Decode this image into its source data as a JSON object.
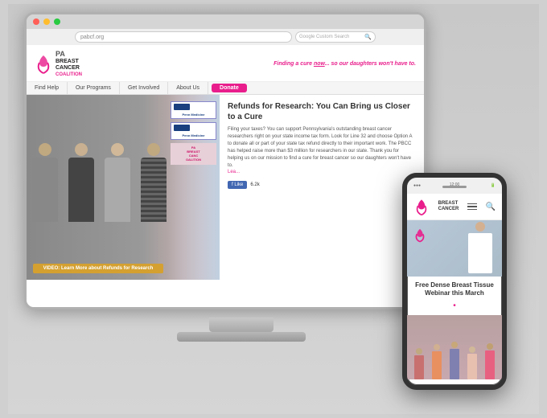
{
  "browser": {
    "traffic_lights": [
      "red",
      "yellow",
      "green"
    ],
    "search_placeholder": "Google Custom Search"
  },
  "website": {
    "logo": {
      "pa": "PA",
      "breast": "BREAST",
      "cancer": "CANCER",
      "coalition": "COALITION"
    },
    "tagline": "Finding a cure now... so our daughters won't have to.",
    "nav": {
      "items": [
        {
          "label": "Find Help"
        },
        {
          "label": "Our Programs"
        },
        {
          "label": "Get Involved"
        },
        {
          "label": "About Us"
        },
        {
          "label": "Donate",
          "highlight": true
        }
      ]
    },
    "hero": {
      "banner_texts": [
        "Penn Medicine",
        "Penn Medicine",
        "PA BREAST CANCER COALITION"
      ],
      "video_btn": "VIDEO: Learn More about Refunds for Research"
    },
    "article": {
      "title": "Refunds for Research: You Can Bring us Closer to a Cure",
      "body": "Filing your taxes? You can support Pennsylvania's outstanding breast cancer researchers right on your state income tax form. Look for Line 32 and choose Option A to donate all or part of your state tax refund directly to their important work. The PBCC has helped raise more than $3 million for researchers in our state. Thank you for helping us on our mission to find a cure for breast cancer so our daughters won't have to.",
      "read_more": "Lea...",
      "fb_count": "6.2k"
    }
  },
  "phone": {
    "article_title": "Free Dense Breast Tissue Webinar this March",
    "ribbon_icon": "♀",
    "menu_icon": "☰",
    "search_icon": "🔍"
  },
  "icons": {
    "facebook": "f",
    "like": "Like",
    "search": "🔍",
    "hamburger": "≡"
  }
}
